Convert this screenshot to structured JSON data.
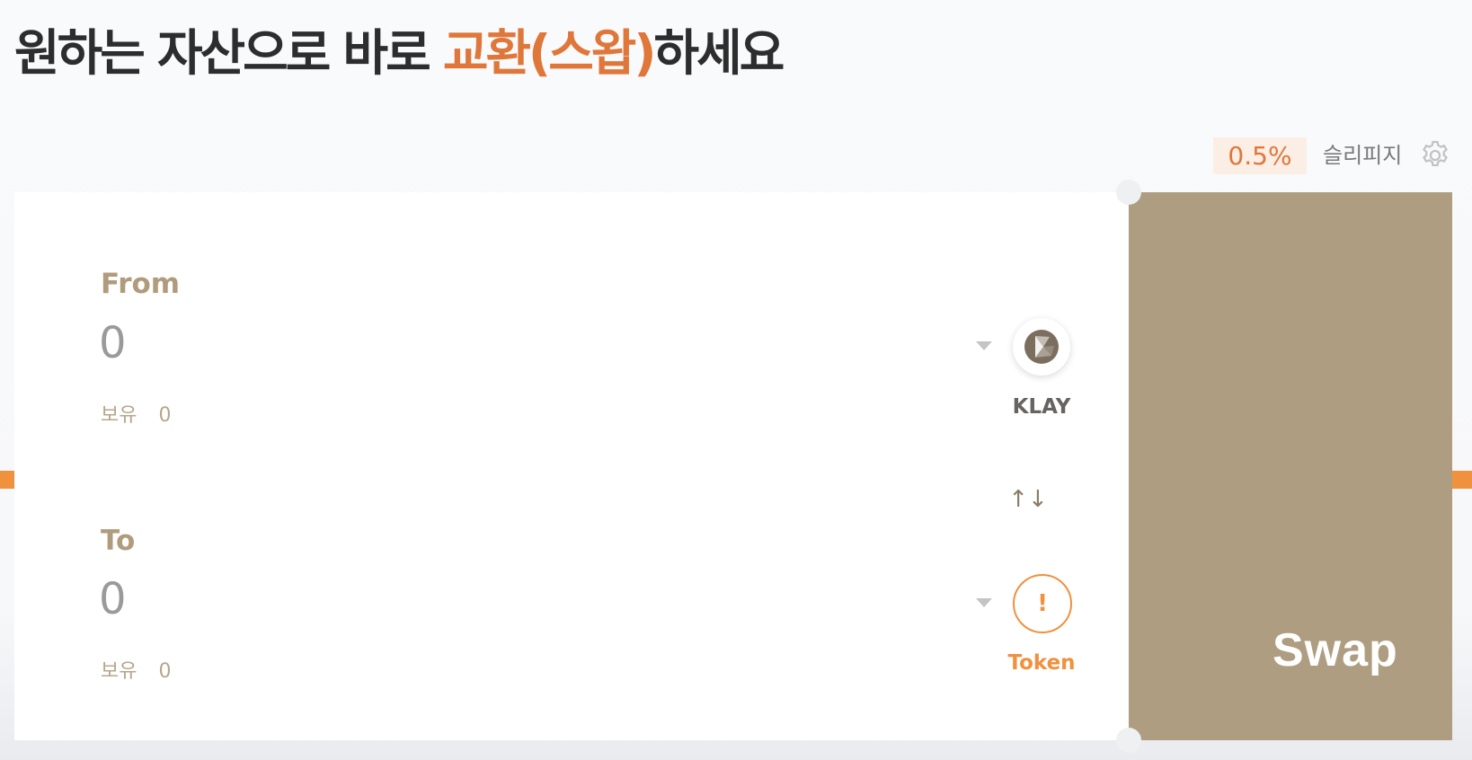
{
  "headline": {
    "part1": "원하는 자산으로 바로 ",
    "accent": "교환(스왑)",
    "part2": "하세요"
  },
  "slippage": {
    "value": "0.5%",
    "label": "슬리피지",
    "settings_icon": "gear-icon"
  },
  "from": {
    "label": "From",
    "amount": "0",
    "balance_label": "보유",
    "balance_value": "0",
    "token_icon": "klay-logo-icon",
    "token_name": "KLAY"
  },
  "switch_icon": "swap-arrows-icon",
  "switch_glyph": "↑↓",
  "to": {
    "label": "To",
    "amount": "0",
    "balance_label": "보유",
    "balance_value": "0",
    "token_icon": "warning-icon",
    "token_glyph": "!",
    "token_name": "Token"
  },
  "swap_button": {
    "label": "Swap"
  },
  "colors": {
    "accent": "#e0773a",
    "brown": "#ae9d80",
    "label_brown": "#b09b7d",
    "orange": "#f0913e"
  }
}
